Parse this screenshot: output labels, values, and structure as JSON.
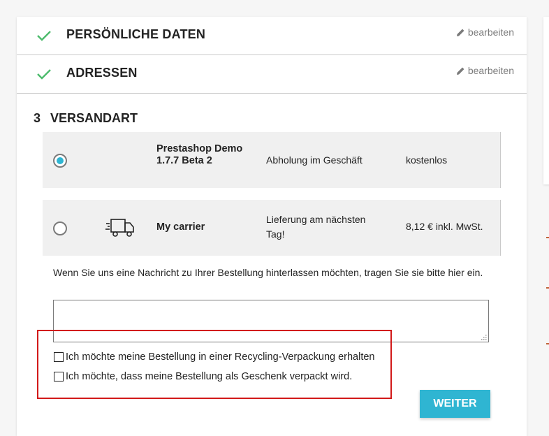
{
  "steps": [
    {
      "title": "Persönliche Daten",
      "edit": "bearbeiten"
    },
    {
      "title": "Adressen",
      "edit": "bearbeiten"
    }
  ],
  "current_step": {
    "number": "3",
    "title": "Versandart"
  },
  "carriers": [
    {
      "name": "Prestashop Demo 1.7.7 Beta 2",
      "delay": "Abholung im Geschäft",
      "price": "kostenlos",
      "selected": true
    },
    {
      "name": "My carrier",
      "delay": "Lieferung am nächsten Tag!",
      "price": "8,12 € inkl. MwSt.",
      "selected": false,
      "icon": "truck-icon"
    }
  ],
  "message": {
    "label": "Wenn Sie uns eine Nachricht zu Ihrer Bestellung hinterlassen möchten, tragen Sie sie bitte hier ein.",
    "value": ""
  },
  "options": [
    {
      "label": "Ich möchte meine Bestellung in einer Recycling-Verpackung erhalten",
      "checked": false
    },
    {
      "label": "Ich möchte, dass meine Bestellung als Geschenk verpackt wird.",
      "checked": false
    }
  ],
  "continue_button": "Weiter",
  "colors": {
    "accent": "#2fb5d2",
    "check": "#4cbb6c",
    "highlight_box": "#d21919"
  }
}
